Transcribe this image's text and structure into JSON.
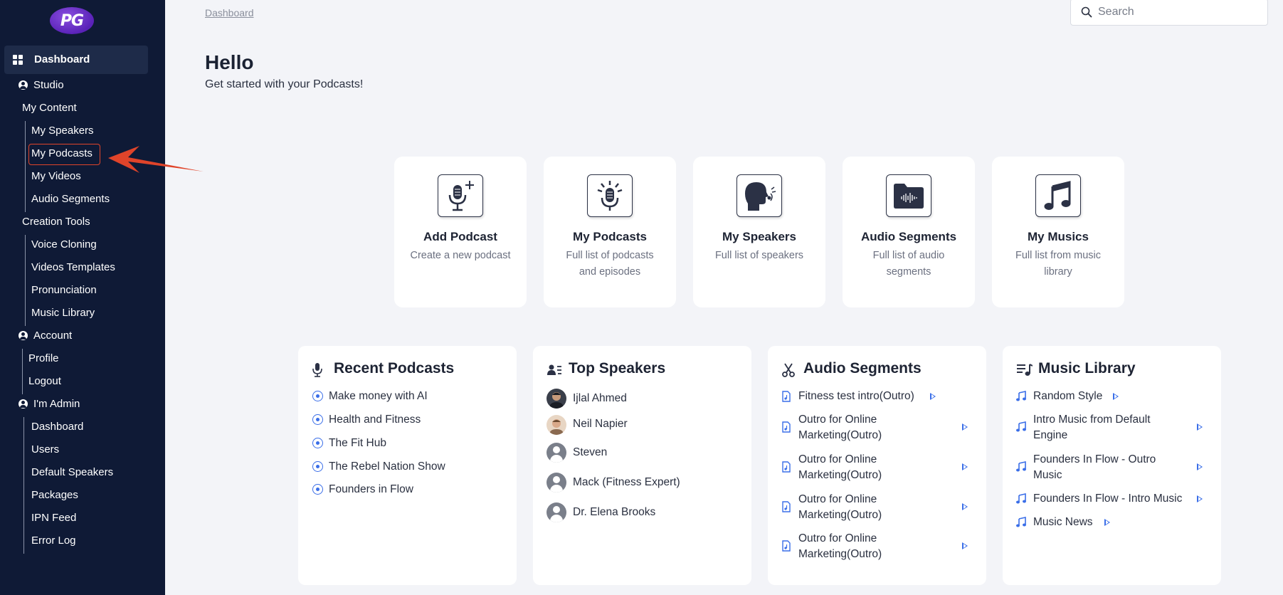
{
  "app": {
    "logo_text": "PG"
  },
  "sidebar": {
    "dashboard": "Dashboard",
    "studio": "Studio",
    "my_content": "My Content",
    "my_content_items": [
      "My Speakers",
      "My Podcasts",
      "My Videos",
      "Audio Segments"
    ],
    "creation_tools": "Creation Tools",
    "creation_items": [
      "Voice Cloning",
      "Videos Templates",
      "Pronunciation",
      "Music Library"
    ],
    "account": "Account",
    "account_items": [
      "Profile",
      "Logout"
    ],
    "admin": "I'm Admin",
    "admin_items": [
      "Dashboard",
      "Users",
      "Default Speakers",
      "Packages",
      "IPN Feed",
      "Error Log"
    ],
    "highlighted_item": "My Podcasts"
  },
  "header": {
    "breadcrumb": "Dashboard",
    "search_placeholder": "Search"
  },
  "main": {
    "greeting": "Hello",
    "subtitle": "Get started with your Podcasts!",
    "quick_cards": [
      {
        "title": "Add Podcast",
        "desc": "Create a new podcast",
        "icon": "mic-plus-icon"
      },
      {
        "title": "My Podcasts",
        "desc": "Full list of podcasts and episodes",
        "icon": "mic-broadcast-icon"
      },
      {
        "title": "My Speakers",
        "desc": "Full list of speakers",
        "icon": "speaker-head-icon"
      },
      {
        "title": "Audio Segments",
        "desc": "Full list of audio segments",
        "icon": "audio-folder-icon"
      },
      {
        "title": "My Musics",
        "desc": "Full list from music library",
        "icon": "music-note-icon"
      }
    ]
  },
  "panels": {
    "recent_podcasts": {
      "title": "Recent Podcasts",
      "items": [
        "Make money with AI",
        "Health and Fitness",
        "The Fit Hub",
        "The Rebel Nation Show",
        "Founders in Flow"
      ]
    },
    "top_speakers": {
      "title": "Top Speakers",
      "items": [
        "Ijlal Ahmed",
        "Neil Napier",
        "Steven",
        "Mack (Fitness Expert)",
        "Dr. Elena Brooks"
      ]
    },
    "audio_segments": {
      "title": "Audio Segments",
      "items": [
        "Fitness test intro(Outro)",
        "Outro for Online Marketing(Outro)",
        "Outro for Online Marketing(Outro)",
        "Outro for Online Marketing(Outro)",
        "Outro for Online Marketing(Outro)"
      ]
    },
    "music_library": {
      "title": "Music Library",
      "items": [
        "Random Style",
        "Intro Music from Default Engine",
        "Founders In Flow - Outro Music",
        "Founders In Flow - Intro Music",
        "Music News"
      ]
    }
  },
  "colors": {
    "sidebar_bg": "#0f1a36",
    "accent": "#3a6ee8",
    "annotation": "#e0442a"
  }
}
